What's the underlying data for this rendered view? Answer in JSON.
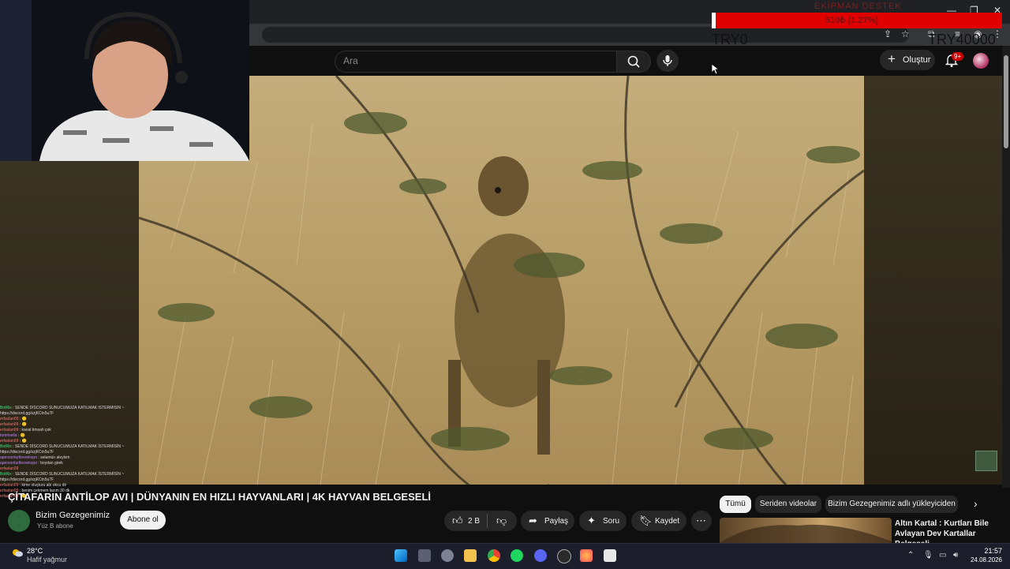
{
  "overlay": {
    "donation_title": "EKİPMAN DESTEK",
    "donation_amount": "510₺ (1.27%)",
    "donation_progress_percent": 1.27,
    "goal_start": "TRY0",
    "goal_end": "TRY40000"
  },
  "youtube": {
    "search_placeholder": "Ara",
    "create_label": "Oluştur",
    "notif_badge": "9+"
  },
  "chat": [
    {
      "user": "BotRix",
      "color": "u-g",
      "msg": ": SENDE DİSCORD SUNUCUMUZA KATILMAK İSTERMİSİN ~"
    },
    {
      "user": "",
      "color": "u-b",
      "msg": "https://discord.gg/szjKCtn5u7F"
    },
    {
      "user": "erfaslan09",
      "color": "u-r",
      "msg": ": 🙂"
    },
    {
      "user": "erfaslan09",
      "color": "u-r",
      "msg": ": 🙂"
    },
    {
      "user": "erfaslan09",
      "color": "u-r",
      "msg": ": kanal timsah çok"
    },
    {
      "user": "tomrisella",
      "color": "u-p",
      "msg": ": 🙂"
    },
    {
      "user": "erfaslan09",
      "color": "u-r",
      "msg": ": 🙂"
    },
    {
      "user": "BotRix",
      "color": "u-g",
      "msg": ": SENDE DİSCORD SUNUCUMUZA KATILMAK İSTERMİSİN ~"
    },
    {
      "user": "",
      "color": "u-b",
      "msg": "https://discord.gg/szjKCtn5u7F"
    },
    {
      "user": "apersonturtlesrekopo",
      "color": "u-p",
      "msg": ": selamün aleykim"
    },
    {
      "user": "apersonturtlesrekopo",
      "color": "u-p",
      "msg": ": boydan girek"
    },
    {
      "user": "",
      "color": "u-b",
      "msg": ""
    },
    {
      "user": "erfaslan09",
      "color": "u-r",
      "msg": ""
    },
    {
      "user": "BotRix",
      "color": "u-g",
      "msg": ": SENDE DİSCORD SUNUCUMUZA KATILMAK İSTERMİSİN ~"
    },
    {
      "user": "",
      "color": "u-b",
      "msg": "https://discord.gg/szjKCtn5u7F"
    },
    {
      "user": "erfaslan09",
      "color": "u-r",
      "msg": ": kime oluşturu abi okcu dir"
    },
    {
      "user": "erfaslan09",
      "color": "u-r",
      "msg": ": benim çekmem lazım 30 dk"
    },
    {
      "user": "erfaslan09",
      "color": "u-r",
      "msg": ": 🙂"
    }
  ],
  "video": {
    "title": "ÇİTAFARIN ANTİLOP AVI | DÜNYANIN EN HIZLI HAYVANLARI | 4K HAYVAN BELGESELİ",
    "channel": "Bizim Gezegenimiz",
    "subscribers": "Yüz B abone",
    "subscribe_label": "Abone ol",
    "likes": "2 B",
    "share_label": "Paylaş",
    "ask_label": "Soru",
    "save_label": "Kaydet"
  },
  "chips": [
    "Tümü",
    "Seriden videolar",
    "Bizim Gezegenimiz adlı yükleyiciden"
  ],
  "recommended": {
    "title": "Altın Kartal : Kurtları Bile Avlayan Dev Kartallar Belgeseli"
  },
  "taskbar": {
    "temperature": "28°C",
    "weather": "Hafif yağmur",
    "time": "21:57",
    "date": "24.08.2026"
  }
}
